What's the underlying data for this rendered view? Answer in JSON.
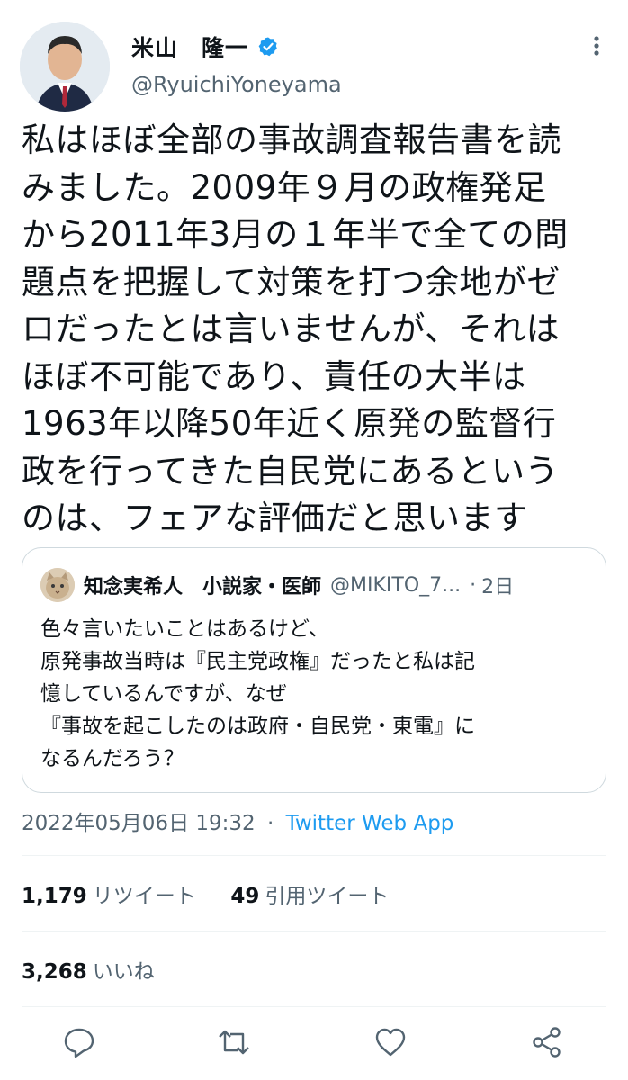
{
  "author": {
    "display_name": "米山　隆一",
    "handle": "@RyuichiYoneyama"
  },
  "tweet": {
    "lines": [
      "私はほぼ全部の事故調査報告書を読",
      "みました。2009年９月の政権発足",
      "から2011年3月の１年半で全ての問",
      "題点を把握して対策を打つ余地がゼ",
      "ロだったとは言いませんが、それは",
      "ほぼ不可能であり、責任の大半は",
      "1963年以降50年近く原発の監督行",
      "政を行ってきた自民党にあるという",
      "のは、フェアな評価だと思います"
    ]
  },
  "quote": {
    "name": "知念実希人　小説家・医師",
    "handle": "@MIKITO_7...",
    "time": "2日",
    "separator": "·",
    "lines": [
      "色々言いたいことはあるけど、",
      "原発事故当時は『民主党政権』だったと私は記",
      "憶しているんですが、なぜ",
      "『事故を起こしたのは政府・自民党・東電』に",
      "なるんだろう？"
    ]
  },
  "meta": {
    "timestamp": "2022年05月06日 19:32",
    "separator": "·",
    "source": "Twitter Web App"
  },
  "stats": {
    "retweets": "1,179",
    "retweets_label": "リツイート",
    "quotes": "49",
    "quotes_label": "引用ツイート",
    "likes": "3,268",
    "likes_label": "いいね"
  },
  "icons": {
    "verified": "verified-badge-icon",
    "more": "more-icon",
    "reply": "reply-icon",
    "retweet": "retweet-icon",
    "like": "like-icon",
    "share": "share-icon"
  },
  "colors": {
    "accent": "#1d9bf0",
    "secondary_text": "#536471",
    "border": "#cfd9de"
  }
}
